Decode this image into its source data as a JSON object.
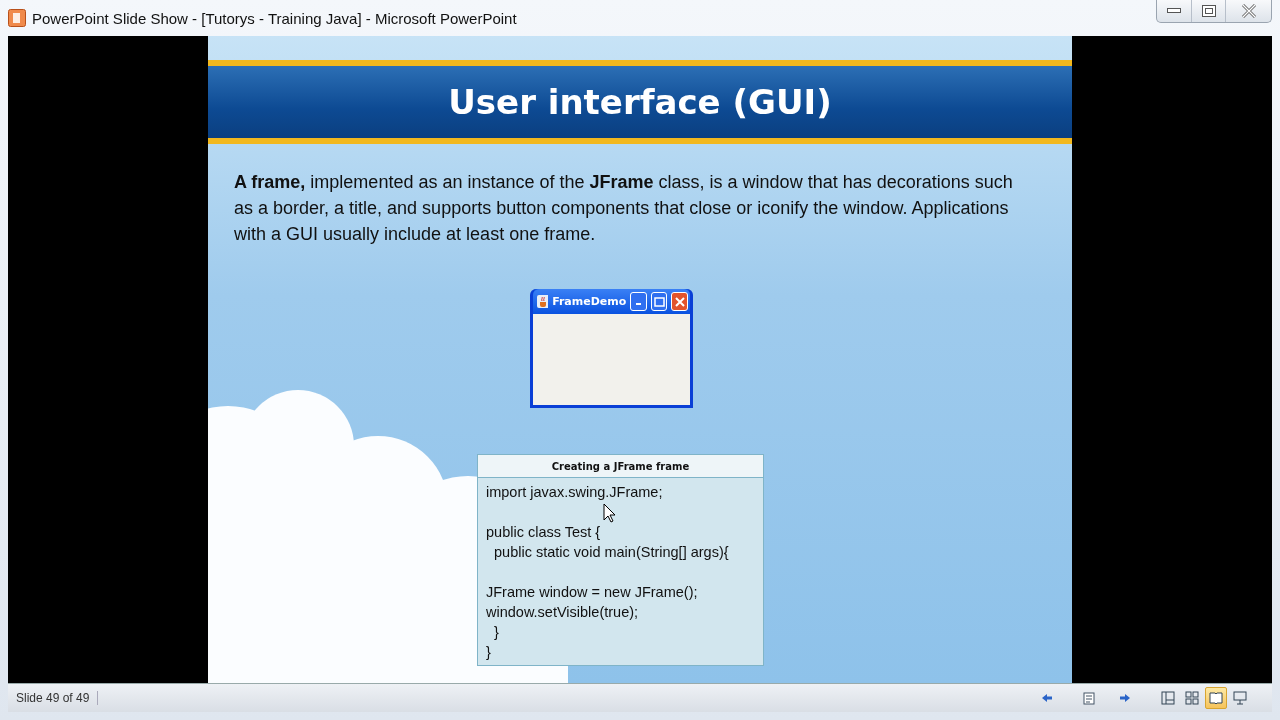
{
  "window": {
    "title": "PowerPoint Slide Show - [Tutorys - Training Java] - Microsoft PowerPoint"
  },
  "slide": {
    "title": "User interface (GUI)",
    "paragraph": "**A frame,** implemented as an instance of the **JFrame** class, is a window that has decorations such as a border, a title, and supports button components that close or iconify the window. Applications with a GUI usually include at least one frame.",
    "frame_demo": {
      "title": "FrameDemo"
    },
    "code_box": {
      "caption": "Creating a JFrame frame",
      "blocks": [
        [
          "import javax.swing.JFrame;"
        ],
        [
          "public class Test {",
          "  public static void main(String[] args){"
        ],
        [
          "JFrame window = new JFrame();",
          "window.setVisible(true);",
          "  }",
          "}"
        ]
      ]
    }
  },
  "status_bar": {
    "slide_counter": "Slide 49 of 49",
    "views": [
      {
        "kind": "normal",
        "selected": false
      },
      {
        "kind": "sorter",
        "selected": false
      },
      {
        "kind": "reading",
        "selected": true
      },
      {
        "kind": "show",
        "selected": false
      }
    ]
  }
}
